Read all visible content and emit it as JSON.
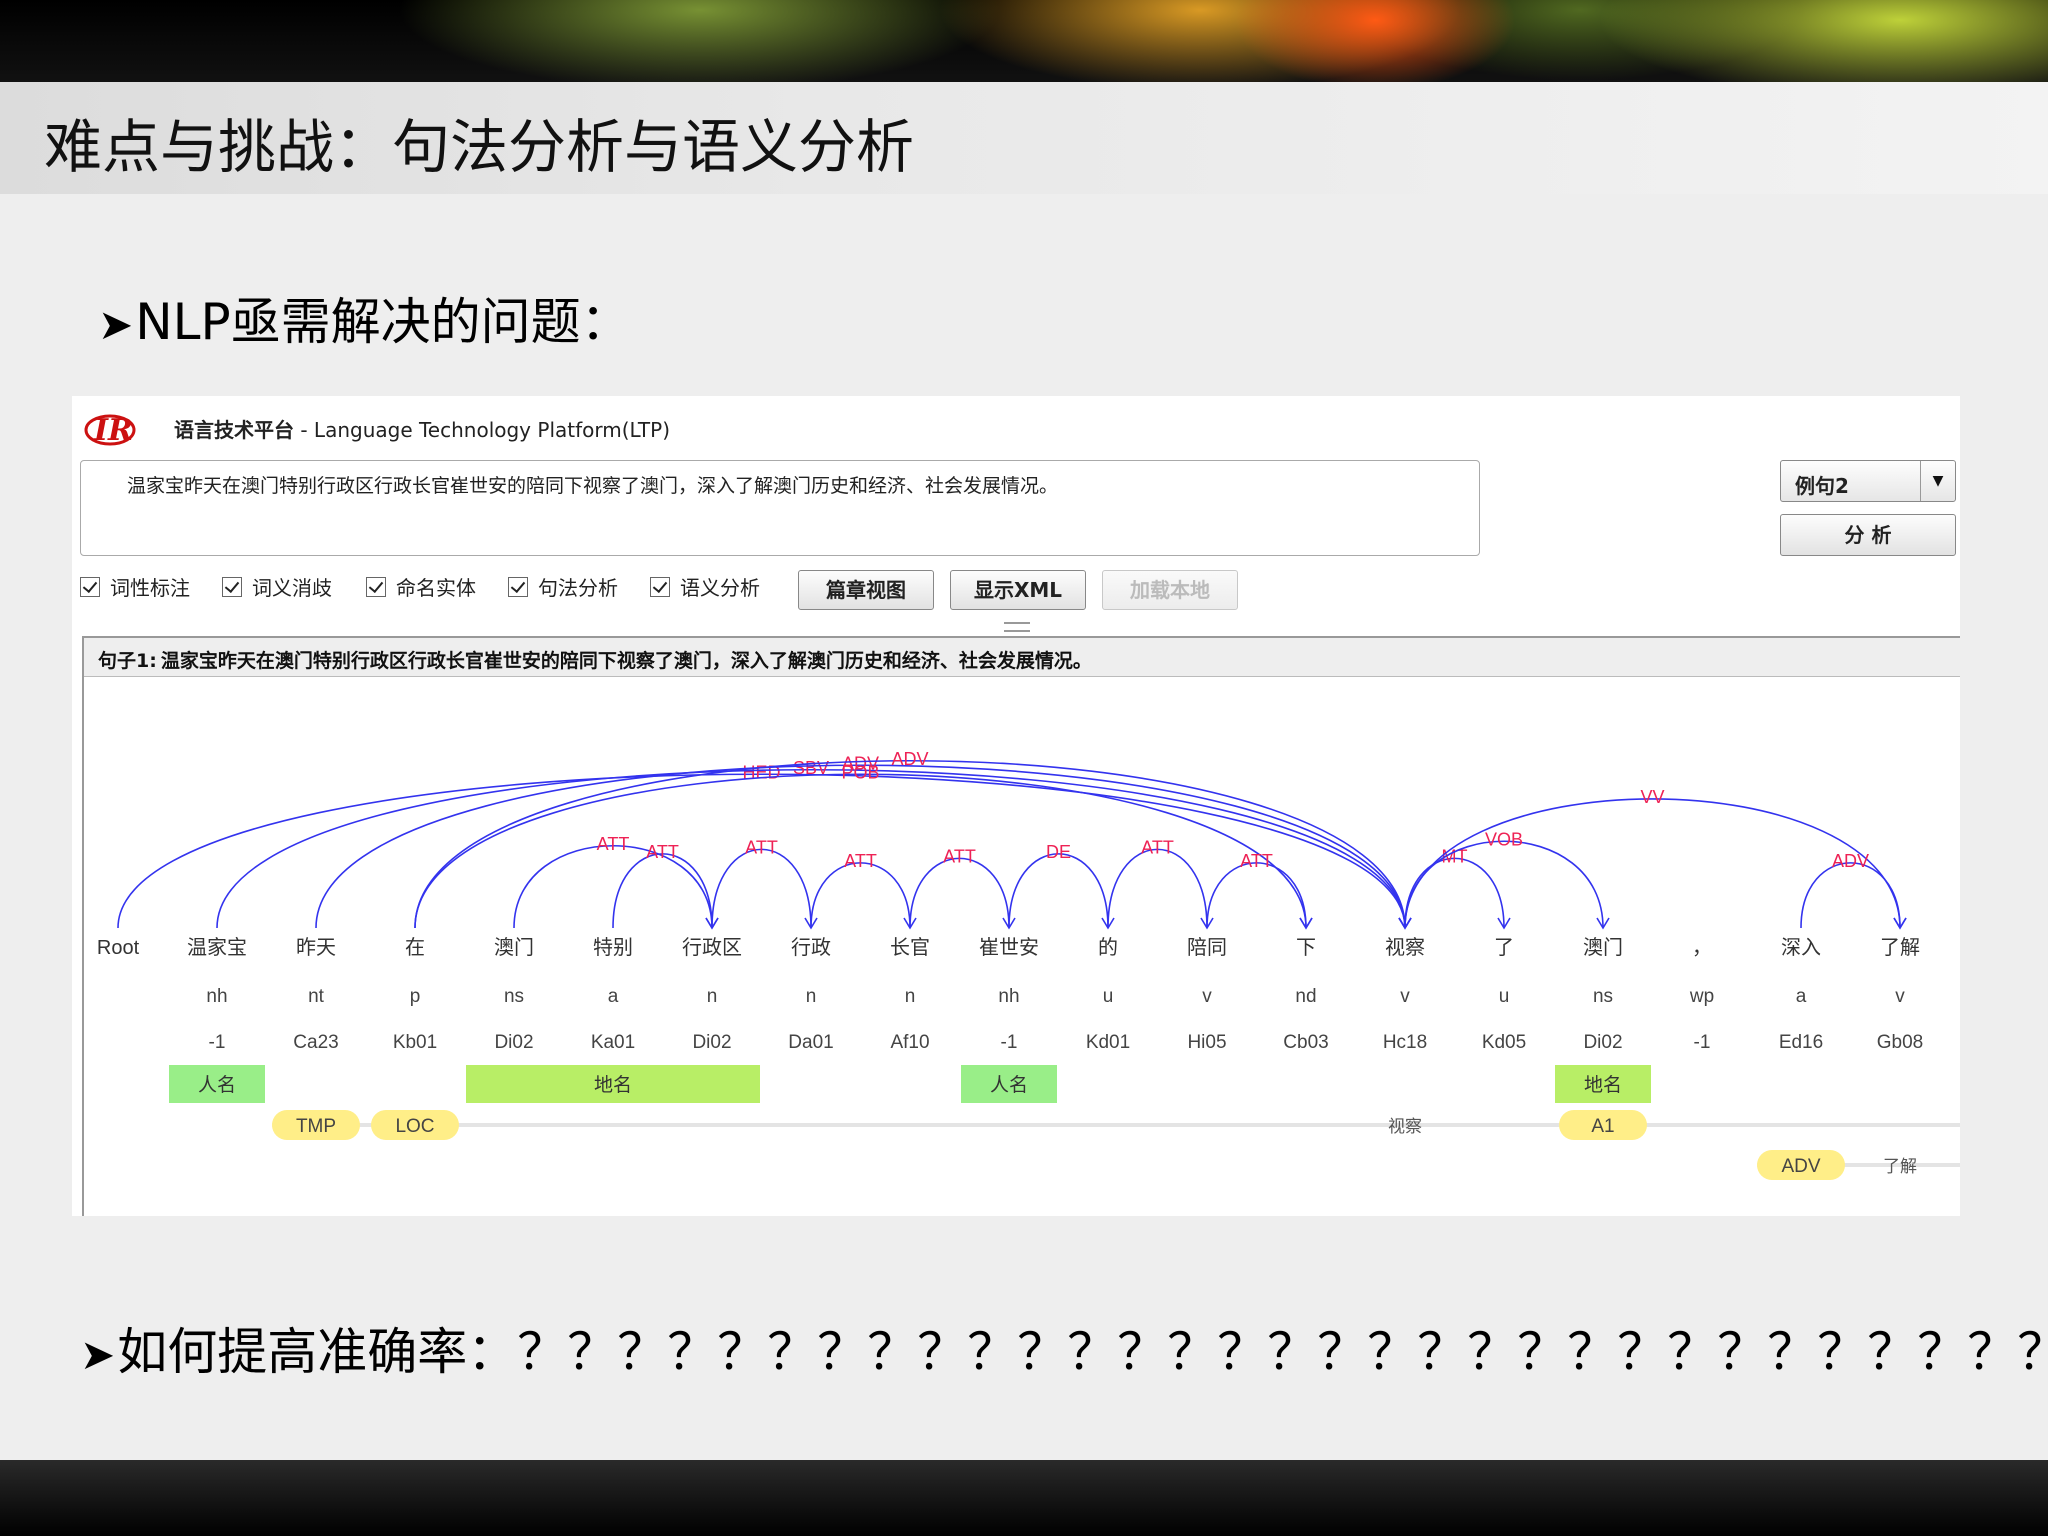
{
  "slide": {
    "title": "难点与挑战：句法分析与语义分析",
    "bullet1": "NLP亟需解决的问题：",
    "bullet2": "如何提高准确率：？？？？？？？？？？？？？？？？？？？？？？？？？？？？？？？"
  },
  "app": {
    "title_cn": "语言技术平台",
    "title_en": " - Language Technology Platform(LTP)",
    "input_text": "温家宝昨天在澳门特别行政区行政长官崔世安的陪同下视察了澳门，深入了解澳门历史和经济、社会发展情况。",
    "example_select": "例句2",
    "analyze_button": "分 析",
    "checkboxes": [
      "词性标注",
      "词义消歧",
      "命名实体",
      "句法分析",
      "语义分析"
    ],
    "buttons": {
      "chapter_view": "篇章视图",
      "show_xml": "显示XML",
      "load_local": "加载本地"
    },
    "sentence_label": "句子1:",
    "sentence_text": "温家宝昨天在澳门特别行政区行政长官崔世安的陪同下视察了澳门，深入了解澳门历史和经济、社会发展情况。"
  },
  "parse": {
    "tokens": [
      {
        "word": "Root",
        "pos": "",
        "sense": ""
      },
      {
        "word": "温家宝",
        "pos": "nh",
        "sense": "-1"
      },
      {
        "word": "昨天",
        "pos": "nt",
        "sense": "Ca23"
      },
      {
        "word": "在",
        "pos": "p",
        "sense": "Kb01"
      },
      {
        "word": "澳门",
        "pos": "ns",
        "sense": "Di02"
      },
      {
        "word": "特别",
        "pos": "a",
        "sense": "Ka01"
      },
      {
        "word": "行政区",
        "pos": "n",
        "sense": "Di02"
      },
      {
        "word": "行政",
        "pos": "n",
        "sense": "Da01"
      },
      {
        "word": "长官",
        "pos": "n",
        "sense": "Af10"
      },
      {
        "word": "崔世安",
        "pos": "nh",
        "sense": "-1"
      },
      {
        "word": "的",
        "pos": "u",
        "sense": "Kd01"
      },
      {
        "word": "陪同",
        "pos": "v",
        "sense": "Hi05"
      },
      {
        "word": "下",
        "pos": "nd",
        "sense": "Cb03"
      },
      {
        "word": "视察",
        "pos": "v",
        "sense": "Hc18"
      },
      {
        "word": "了",
        "pos": "u",
        "sense": "Kd05"
      },
      {
        "word": "澳门",
        "pos": "ns",
        "sense": "Di02"
      },
      {
        "word": "，",
        "pos": "wp",
        "sense": "-1"
      },
      {
        "word": "深入",
        "pos": "a",
        "sense": "Ed16"
      },
      {
        "word": "了解",
        "pos": "v",
        "sense": "Gb08"
      }
    ],
    "arcs": [
      {
        "from": 0,
        "to": 13,
        "label": "HED"
      },
      {
        "from": 1,
        "to": 13,
        "label": "SBV"
      },
      {
        "from": 2,
        "to": 13,
        "label": "ADV"
      },
      {
        "from": 3,
        "to": 13,
        "label": "ADV"
      },
      {
        "from": 3,
        "to": 12,
        "label": "POB"
      },
      {
        "from": 4,
        "to": 6,
        "label": "ATT"
      },
      {
        "from": 5,
        "to": 6,
        "label": "ATT"
      },
      {
        "from": 6,
        "to": 7,
        "label": "ATT"
      },
      {
        "from": 7,
        "to": 8,
        "label": "ATT"
      },
      {
        "from": 8,
        "to": 9,
        "label": "ATT"
      },
      {
        "from": 9,
        "to": 10,
        "label": "DE"
      },
      {
        "from": 10,
        "to": 11,
        "label": "ATT"
      },
      {
        "from": 11,
        "to": 12,
        "label": "ATT"
      },
      {
        "from": 13,
        "to": 14,
        "label": "MT"
      },
      {
        "from": 13,
        "to": 15,
        "label": "VOB"
      },
      {
        "from": 13,
        "to": 18,
        "label": "VV"
      },
      {
        "from": 17,
        "to": 18,
        "label": "ADV"
      }
    ],
    "ner": [
      {
        "start": 1,
        "end": 1,
        "label": "人名"
      },
      {
        "start": 4,
        "end": 6,
        "label": "地名"
      },
      {
        "start": 9,
        "end": 9,
        "label": "人名"
      },
      {
        "start": 15,
        "end": 15,
        "label": "地名"
      }
    ],
    "srl": [
      {
        "predicate": "视察",
        "args": [
          {
            "token": 2,
            "label": "TMP"
          },
          {
            "token": 3,
            "label": "LOC"
          },
          {
            "token": 15,
            "label": "A1"
          }
        ]
      },
      {
        "predicate": "了解",
        "args": [
          {
            "token": 17,
            "label": "ADV"
          }
        ]
      }
    ]
  },
  "colors": {
    "arc": "#3333ee",
    "arc_label": "#ee2255",
    "ner": "#b8ee66",
    "ner_person": "#99ee88",
    "srl": "#ffee88",
    "logo": "#cc1111"
  }
}
